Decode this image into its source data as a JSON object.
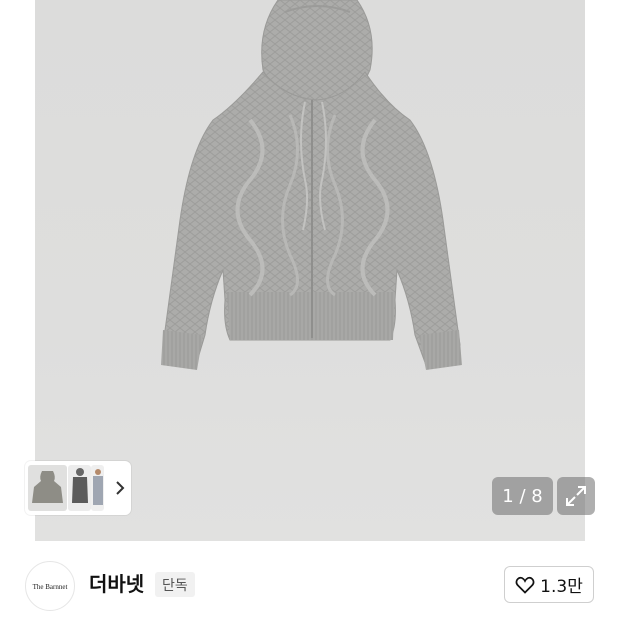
{
  "gallery": {
    "counter_text": "1 / 8",
    "thumbnail_count": 3,
    "next_icon": "chevron-right-icon",
    "expand_icon": "expand-icon"
  },
  "seller": {
    "logo_text": "The Barnnet",
    "name": "더바넷",
    "badge": "단독"
  },
  "like": {
    "icon": "heart-outline-icon",
    "count": "1.3만"
  },
  "colors": {
    "photo_background": "#dcdcdb",
    "sweater": "#a9a9a7",
    "overlay": "#6e6e6e"
  }
}
